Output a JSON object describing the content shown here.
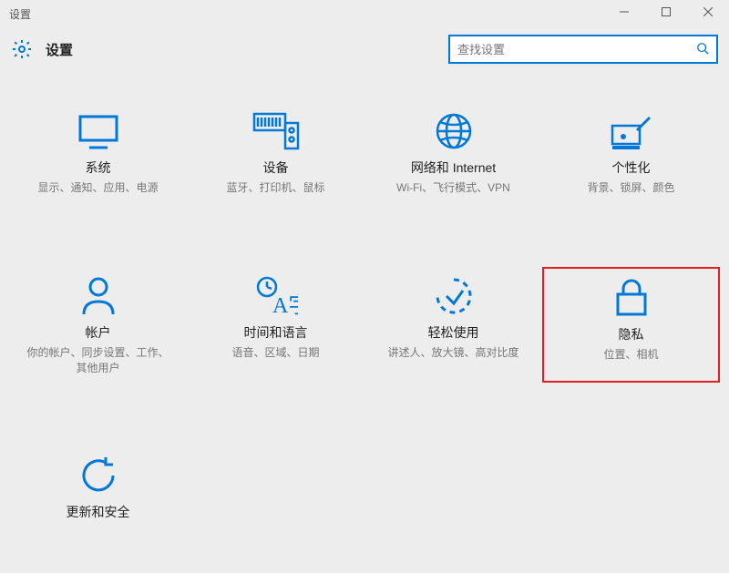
{
  "window": {
    "title": "设置",
    "heading": "设置"
  },
  "search": {
    "placeholder": "查找设置"
  },
  "tiles": [
    {
      "id": "system",
      "title": "系统",
      "desc": "显示、通知、应用、电源"
    },
    {
      "id": "devices",
      "title": "设备",
      "desc": "蓝牙、打印机、鼠标"
    },
    {
      "id": "network",
      "title": "网络和 Internet",
      "desc": "Wi-Fi、飞行模式、VPN"
    },
    {
      "id": "personalize",
      "title": "个性化",
      "desc": "背景、锁屏、颜色"
    },
    {
      "id": "accounts",
      "title": "帐户",
      "desc": "你的帐户、同步设置、工作、其他用户"
    },
    {
      "id": "time-language",
      "title": "时间和语言",
      "desc": "语音、区域、日期"
    },
    {
      "id": "ease-access",
      "title": "轻松使用",
      "desc": "讲述人、放大镜、高对比度"
    },
    {
      "id": "privacy",
      "title": "隐私",
      "desc": "位置、相机",
      "highlight": true
    },
    {
      "id": "update",
      "title": "更新和安全",
      "desc": ""
    }
  ]
}
